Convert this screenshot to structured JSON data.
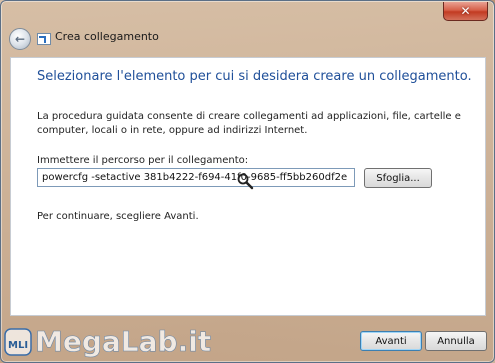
{
  "window": {
    "title": "Crea collegamento",
    "close_label": "✕"
  },
  "wizard": {
    "heading": "Selezionare l'elemento per cui si desidera creare un collegamento.",
    "description": "La procedura guidata consente di creare collegamenti ad applicazioni, file, cartelle e computer, locali o in rete, oppure ad indirizzi Internet.",
    "path_label": "Immettere il percorso per il collegamento:",
    "path_value": "powercfg -setactive 381b4222-f694-41f0-9685-ff5bb260df2e",
    "browse_label": "Sfoglia...",
    "continue_hint": "Per continuare, scegliere Avanti."
  },
  "footer": {
    "next_label": "Avanti",
    "cancel_label": "Annulla"
  },
  "watermark": {
    "logo_text": "MegaLab.it",
    "badge_text": "MLI"
  }
}
